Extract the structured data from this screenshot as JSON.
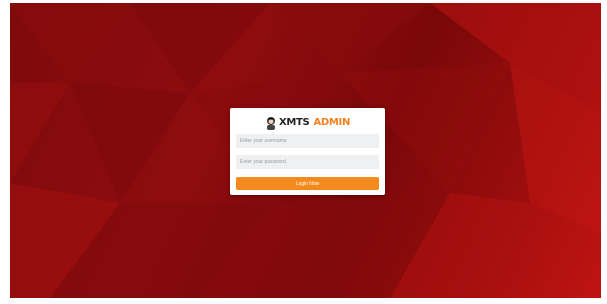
{
  "logo": {
    "brand": "XMTS",
    "sub": "ADMIN",
    "icon": "mascot-logo-icon"
  },
  "form": {
    "username_placeholder": "Enter your username",
    "password_placeholder": "Enter your password",
    "login_label": "Login Now"
  },
  "colors": {
    "background": "#8f0c0e",
    "accent": "#f58a1f",
    "card": "#ffffff",
    "field": "#eef0f2"
  }
}
